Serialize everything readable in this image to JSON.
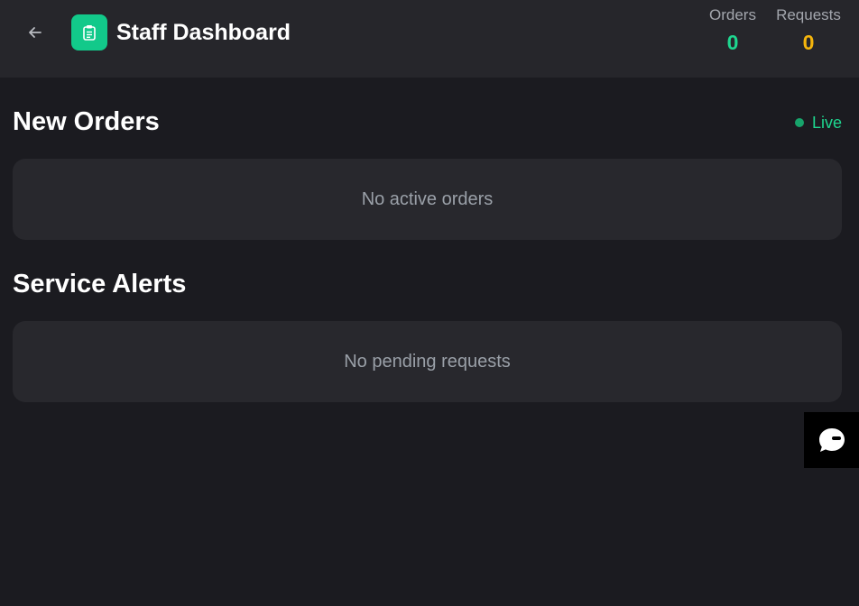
{
  "header": {
    "back_icon": "arrow-left-icon",
    "app_icon": "clipboard-icon",
    "title": "Staff Dashboard",
    "stats": {
      "orders": {
        "label": "Orders",
        "value": "0",
        "color": "#1ed68f"
      },
      "requests": {
        "label": "Requests",
        "value": "0",
        "color": "#f5b50c"
      }
    }
  },
  "colors": {
    "accent_green": "#1ed68f",
    "app_icon_bg": "#12c98a",
    "live_dot": "#17a46b",
    "page_bg": "#1b1b20",
    "header_bg": "#26262b",
    "card_bg": "#28282d"
  },
  "orders_section": {
    "title": "New Orders",
    "live_label": "Live",
    "empty_text": "No active orders"
  },
  "alerts_section": {
    "title": "Service Alerts",
    "empty_text": "No pending requests"
  },
  "chat_widget": {
    "icon": "chat-bubble-icon"
  }
}
